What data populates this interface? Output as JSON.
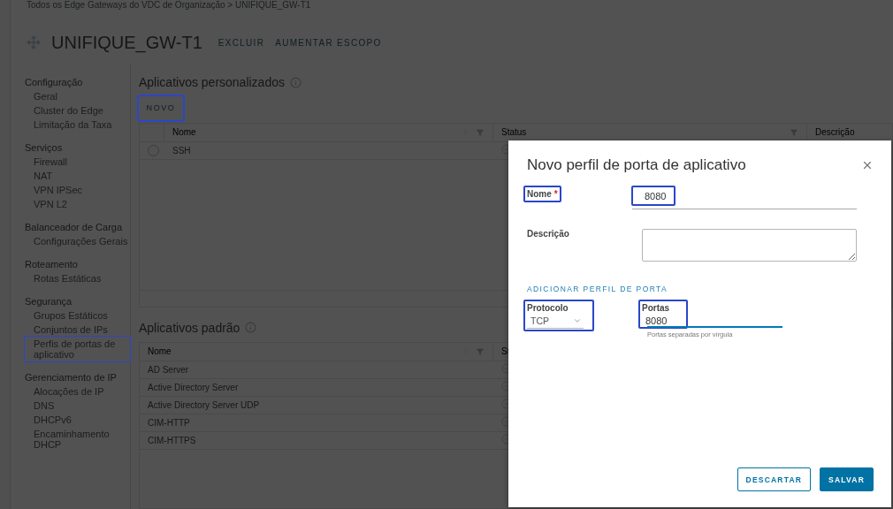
{
  "breadcrumb": "Todos os Edge Gateways do VDC de Organização > UNIFIQUE_GW-T1",
  "header": {
    "title": "UNIFIQUE_GW-T1",
    "actions": [
      "EXCLUIR",
      "AUMENTAR ESCOPO"
    ]
  },
  "sidebar": {
    "groups": [
      {
        "label": "Configuração",
        "items": [
          {
            "label": "Geral",
            "highlighted": false
          },
          {
            "label": "Cluster do Edge",
            "highlighted": false
          },
          {
            "label": "Limitação da Taxa",
            "highlighted": false
          }
        ]
      },
      {
        "label": "Serviços",
        "items": [
          {
            "label": "Firewall",
            "highlighted": false
          },
          {
            "label": "NAT",
            "highlighted": false
          },
          {
            "label": "VPN IPSec",
            "highlighted": false
          },
          {
            "label": "VPN L2",
            "highlighted": false
          }
        ]
      },
      {
        "label": "Balanceador de Carga",
        "items": [
          {
            "label": "Configurações Gerais",
            "highlighted": false
          }
        ]
      },
      {
        "label": "Roteamento",
        "items": [
          {
            "label": "Rotas Estáticas",
            "highlighted": false
          }
        ]
      },
      {
        "label": "Segurança",
        "items": [
          {
            "label": "Grupos Estáticos",
            "highlighted": false
          },
          {
            "label": "Conjuntos de IPs",
            "highlighted": false
          },
          {
            "label": "Perfis de portas de aplicativo",
            "highlighted": true
          }
        ]
      },
      {
        "label": "Gerenciamento de IP",
        "items": [
          {
            "label": "Alocações de IP",
            "highlighted": false
          },
          {
            "label": "DNS",
            "highlighted": false
          },
          {
            "label": "DHCPv6",
            "highlighted": false
          },
          {
            "label": "Encaminhamento DHCP",
            "highlighted": false
          }
        ]
      }
    ]
  },
  "custom_apps": {
    "title": "Aplicativos personalizados",
    "new_button": {
      "label": "NOVO",
      "highlighted": true
    },
    "columns": [
      "Nome",
      "Status",
      "Descrição"
    ],
    "rows": [
      {
        "name": "SSH",
        "selected": false
      }
    ]
  },
  "default_apps": {
    "title": "Aplicativos padrão",
    "columns": [
      "Nome",
      "St"
    ],
    "rows": [
      {
        "name": "AD Server"
      },
      {
        "name": "Active Directory Server"
      },
      {
        "name": "Active Directory Server UDP"
      },
      {
        "name": "CIM-HTTP"
      },
      {
        "name": "CIM-HTTPS"
      }
    ]
  },
  "dialog": {
    "title": "Novo perfil de porta de aplicativo",
    "name_field": {
      "label": "Nome",
      "required_mark": "*",
      "value": "8080",
      "label_highlighted": true,
      "value_highlighted": true
    },
    "description_field": {
      "label": "Descrição"
    },
    "section_link": "ADICIONAR PERFIL DE PORTA",
    "protocol_field": {
      "label": "Protocolo",
      "value": "TCP",
      "highlighted": true
    },
    "ports_field": {
      "label": "Portas",
      "value": "8080",
      "hint": "Portas separadas por vírgula",
      "highlighted": true,
      "focused": true
    },
    "buttons": [
      {
        "label": "DESCARTAR",
        "kind": "secondary"
      },
      {
        "label": "SALVAR",
        "kind": "primary"
      }
    ]
  }
}
